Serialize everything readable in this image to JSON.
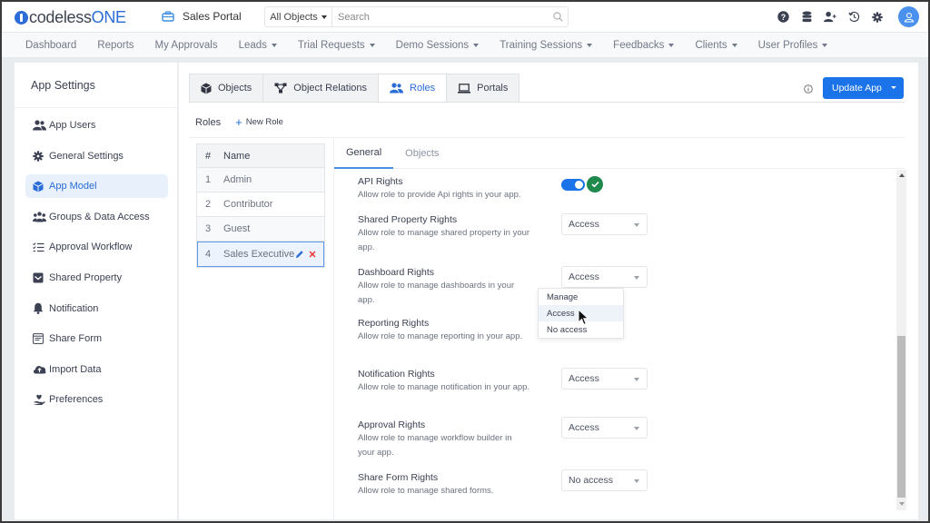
{
  "brand": {
    "name_prefix": "codeless",
    "name_suffix": "ONE"
  },
  "portal": {
    "name": "Sales Portal"
  },
  "search": {
    "scope": "All Objects",
    "placeholder": "Search",
    "value": ""
  },
  "top_icons": [
    "help-icon",
    "database-icon",
    "add-user-icon",
    "history-icon",
    "settings-icon",
    "user-avatar"
  ],
  "nav": {
    "items": [
      {
        "label": "Dashboard",
        "dropdown": false
      },
      {
        "label": "Reports",
        "dropdown": false
      },
      {
        "label": "My Approvals",
        "dropdown": false
      },
      {
        "label": "Leads",
        "dropdown": true
      },
      {
        "label": "Trial Requests",
        "dropdown": true
      },
      {
        "label": "Demo Sessions",
        "dropdown": true
      },
      {
        "label": "Training Sessions",
        "dropdown": true
      },
      {
        "label": "Feedbacks",
        "dropdown": true
      },
      {
        "label": "Clients",
        "dropdown": true
      },
      {
        "label": "User Profiles",
        "dropdown": true
      }
    ]
  },
  "sidebar": {
    "title": "App Settings",
    "items": [
      {
        "label": "App Users",
        "icon": "users-icon",
        "active": false
      },
      {
        "label": "General Settings",
        "icon": "gear-icon",
        "active": false
      },
      {
        "label": "App Model",
        "icon": "cube-icon",
        "active": true
      },
      {
        "label": "Groups & Data Access",
        "icon": "groups-icon",
        "active": false
      },
      {
        "label": "Approval Workflow",
        "icon": "checklist-icon",
        "active": false
      },
      {
        "label": "Shared Property",
        "icon": "inbox-icon",
        "active": false
      },
      {
        "label": "Notification",
        "icon": "bell-icon",
        "active": false
      },
      {
        "label": "Share Form",
        "icon": "form-icon",
        "active": false
      },
      {
        "label": "Import Data",
        "icon": "cloud-upload-icon",
        "active": false
      },
      {
        "label": "Preferences",
        "icon": "hand-heart-icon",
        "active": false
      }
    ]
  },
  "tabs": [
    {
      "label": "Objects",
      "icon": "cube-icon",
      "active": false
    },
    {
      "label": "Object Relations",
      "icon": "relations-icon",
      "active": false
    },
    {
      "label": "Roles",
      "icon": "users-icon",
      "active": true
    },
    {
      "label": "Portals",
      "icon": "laptop-icon",
      "active": false
    }
  ],
  "actions": {
    "update_label": "Update App"
  },
  "roles_bar": {
    "title": "Roles",
    "new_role_label": "New Role"
  },
  "roles_table": {
    "headers": [
      "#",
      "Name"
    ],
    "rows": [
      {
        "num": "1",
        "name": "Admin",
        "selected": false
      },
      {
        "num": "2",
        "name": "Contributor",
        "selected": false
      },
      {
        "num": "3",
        "name": "Guest",
        "selected": false
      },
      {
        "num": "4",
        "name": "Sales Executive",
        "selected": true
      }
    ]
  },
  "subtabs": [
    {
      "label": "General",
      "active": true
    },
    {
      "label": "Objects",
      "active": false
    }
  ],
  "settings": [
    {
      "title": "API Rights",
      "desc": "Allow role to provide Api rights in your app.",
      "type": "toggle",
      "value": true
    },
    {
      "title": "Shared Property Rights",
      "desc": "Allow role to manage shared property in your app.",
      "type": "select",
      "value": "Access"
    },
    {
      "title": "Dashboard Rights",
      "desc": "Allow role to manage dashboards in your app.",
      "type": "select",
      "value": "Access"
    },
    {
      "title": "Reporting Rights",
      "desc": "Allow role to manage reporting in your app.",
      "type": "select",
      "value": ""
    },
    {
      "title": "Notification Rights",
      "desc": "Allow role to manage notification in your app.",
      "type": "select",
      "value": "Access"
    },
    {
      "title": "Approval Rights",
      "desc": "Allow role to manage workflow builder in your app.",
      "type": "select",
      "value": "Access"
    },
    {
      "title": "Share Form Rights",
      "desc": "Allow role to manage shared forms.",
      "type": "select",
      "value": "No access"
    }
  ],
  "dropdown_menu": {
    "options": [
      "Manage",
      "Access",
      "No access"
    ],
    "hovered": "Access"
  },
  "colors": {
    "accent": "#1a73e8",
    "success": "#1f8a4c",
    "danger": "#e53935"
  }
}
